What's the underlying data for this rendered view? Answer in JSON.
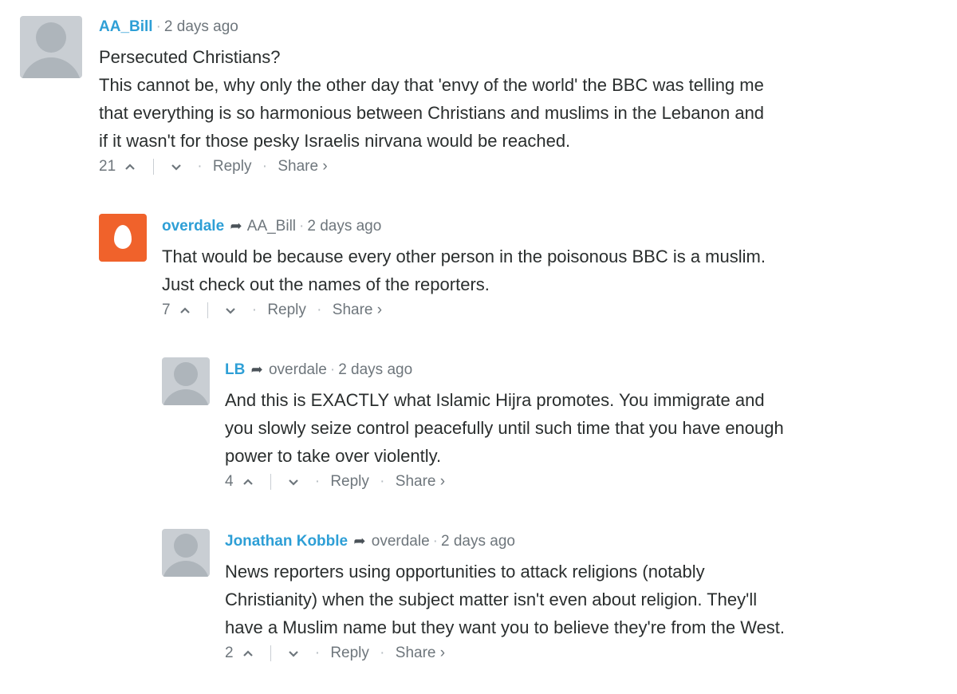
{
  "comments": [
    {
      "author": "AA_Bill",
      "parent": "",
      "time": "2 days ago",
      "lines": [
        "Persecuted Christians?",
        "This cannot be, why only the other day that 'envy of the world' the BBC was telling me",
        "that everything is so harmonious between Christians and muslims in the Lebanon and",
        "if it wasn't for those pesky Israelis nirvana would be reached."
      ],
      "votes": "21",
      "reply": "Reply",
      "share": "Share ›"
    },
    {
      "author": "overdale",
      "parent": "AA_Bill",
      "time": "2 days ago",
      "lines": [
        "That would be because every other person in the poisonous BBC is a muslim.",
        "Just check out the names of the reporters."
      ],
      "votes": "7",
      "reply": "Reply",
      "share": "Share ›"
    },
    {
      "author": "LB",
      "parent": "overdale",
      "time": "2 days ago",
      "lines": [
        "And this is EXACTLY what Islamic Hijra promotes. You immigrate and",
        "you slowly seize control peacefully until such time that you have enough",
        "power to take over violently."
      ],
      "votes": "4",
      "reply": "Reply",
      "share": "Share ›"
    },
    {
      "author": "Jonathan Kobble",
      "parent": "overdale",
      "time": "2 days ago",
      "lines": [
        "News reporters using opportunities to attack religions (notably",
        "Christianity) when the subject matter isn't even about religion. They'll",
        "have a Muslim name but they want you to believe they're from the West."
      ],
      "votes": "2",
      "reply": "Reply",
      "share": "Share ›"
    }
  ],
  "icons": {
    "avatar_default": "default-avatar-icon",
    "avatar_egg": "egg-avatar-icon",
    "reply_arrow": "reply-arrow-icon",
    "upvote": "upvote-icon",
    "downvote": "downvote-icon"
  },
  "colors": {
    "author": "#2e9fd6",
    "egg_avatar": "#f0622b"
  }
}
